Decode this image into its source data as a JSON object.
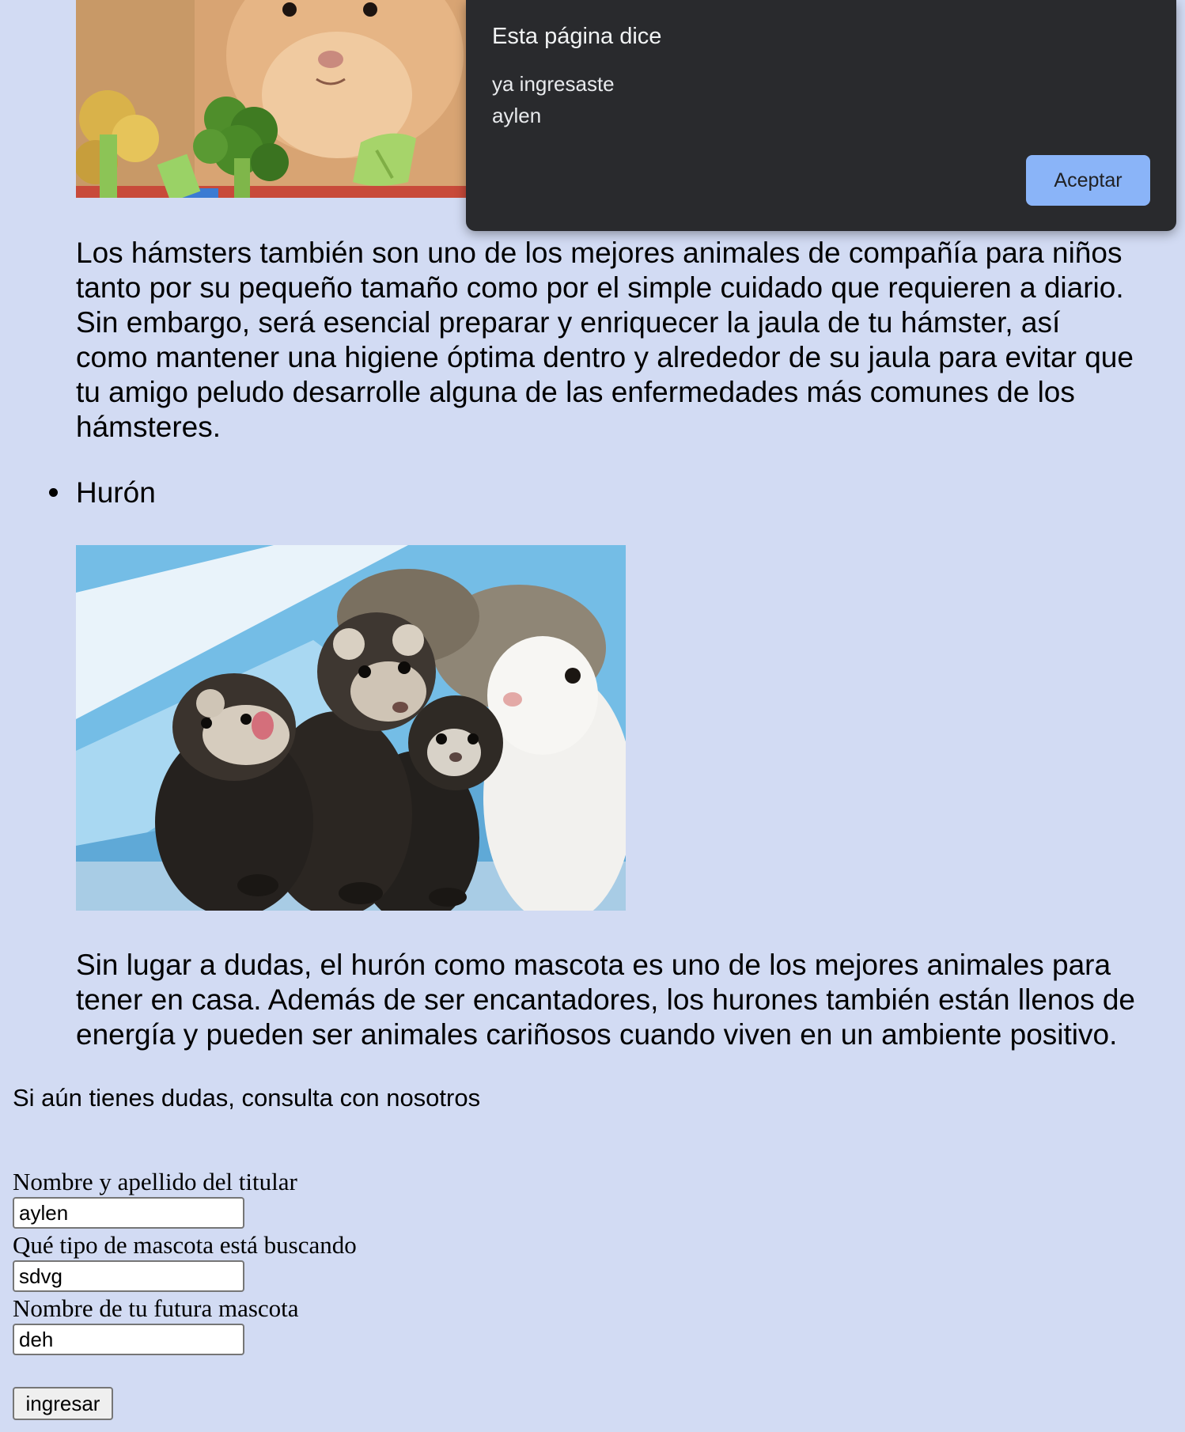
{
  "hamster_section": {
    "paragraph_lines": [
      "Los hámsters también son uno de los mejores animales de compañía para niños",
      "tanto por su pequeño tamaño como por el simple cuidado que requieren a diario.",
      "Sin embargo, será esencial preparar y enriquecer la jaula de tu hámster, así",
      "como mantener una higiene óptima dentro y alrededor de su jaula para evitar que",
      "tu amigo peludo desarrolle alguna de las enfermedades más comunes de los",
      "hámsteres."
    ]
  },
  "ferret_section": {
    "bullet_label": "Hurón",
    "paragraph_lines": [
      "Sin lugar a dudas, el hurón como mascota es uno de los mejores animales para",
      "tener en casa. Además de ser encantadores, los hurones también están llenos de",
      "energía y pueden ser animales cariñosos cuando viven en un ambiente positivo."
    ]
  },
  "consult_text": "Si aún tienes dudas, consulta con nosotros",
  "form": {
    "name_label": "Nombre y apellido del titular",
    "name_value": "aylen",
    "pet_type_label": "Qué tipo de mascota está buscando",
    "pet_type_value": "sdvg",
    "pet_name_label": "Nombre de tu futura mascota",
    "pet_name_value": "deh",
    "submit_label": "ingresar"
  },
  "alert": {
    "title": "Esta página dice",
    "message_lines": [
      "ya ingresaste",
      "aylen"
    ],
    "accept_label": "Aceptar"
  },
  "colors": {
    "page_background": "#d2dbf3",
    "dialog_background": "#292a2d",
    "dialog_button": "#8ab4f8"
  }
}
